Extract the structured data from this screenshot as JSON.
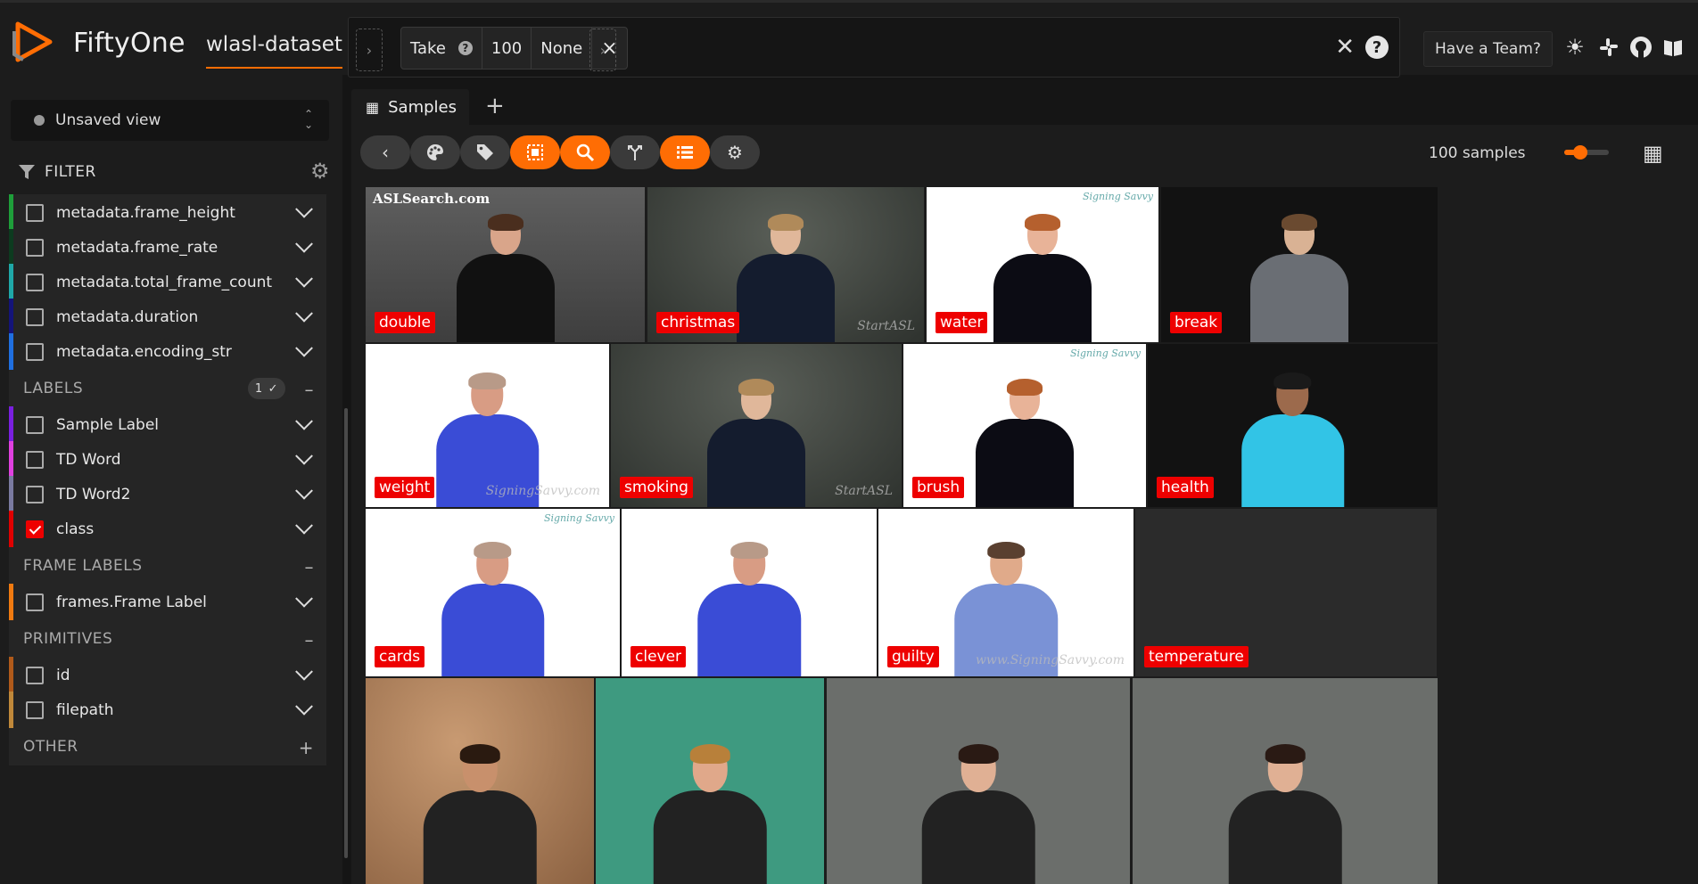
{
  "header": {
    "brand": "FiftyOne",
    "dataset_name": "wlasl-dataset",
    "view_stage": {
      "name": "Take",
      "help": "?",
      "value": "100",
      "seed": "None",
      "remove": "×"
    },
    "expand_left": "›",
    "expand_right": "›",
    "clear": "✕",
    "help": "?",
    "team_button": "Have a Team?",
    "icons": [
      "sun-icon",
      "slack-icon",
      "github-icon",
      "docs-icon"
    ]
  },
  "sidebar": {
    "saved_view": "Unsaved view",
    "filter_title": "FILTER",
    "metadata_fields": [
      {
        "label": "metadata.frame_height",
        "color": "#1e9e3a"
      },
      {
        "label": "metadata.frame_rate",
        "color": "#0d3b1f"
      },
      {
        "label": "metadata.total_frame_count",
        "color": "#1fa8a8"
      },
      {
        "label": "metadata.duration",
        "color": "#14147a"
      },
      {
        "label": "metadata.encoding_str",
        "color": "#1f6fe0"
      }
    ],
    "labels_group": {
      "title": "LABELS",
      "count": "1",
      "toggle": "–"
    },
    "label_fields": [
      {
        "label": "Sample Label",
        "color": "#7a1fe0",
        "checked": false
      },
      {
        "label": "TD Word",
        "color": "#e040e0",
        "checked": false
      },
      {
        "label": "TD Word2",
        "color": "#7a7aa0",
        "checked": false
      },
      {
        "label": "class",
        "color": "#e00000",
        "checked": true
      }
    ],
    "frame_labels_group": {
      "title": "FRAME LABELS",
      "toggle": "–"
    },
    "frame_label_fields": [
      {
        "label": "frames.Frame Label",
        "color": "#f07a10",
        "checked": false
      }
    ],
    "primitives_group": {
      "title": "PRIMITIVES",
      "toggle": "–"
    },
    "primitive_fields": [
      {
        "label": "id",
        "color": "#b05a1a",
        "checked": false
      },
      {
        "label": "filepath",
        "color": "#c0883a",
        "checked": false
      }
    ],
    "other_group": {
      "title": "OTHER",
      "toggle": "+"
    }
  },
  "tabs": {
    "samples": "Samples",
    "add": "+"
  },
  "actions": {
    "sample_count": "100 samples",
    "accent": "#ff6d04"
  },
  "gallery": {
    "samples": [
      {
        "label": "double",
        "watermark_tl": "ASLSearch.com"
      },
      {
        "label": "christmas",
        "watermark_br": "StartASL"
      },
      {
        "label": "water",
        "watermark_tr": "Signing Savvy"
      },
      {
        "label": "break"
      },
      {
        "label": "weight",
        "watermark_br": "SigningSavvy.com"
      },
      {
        "label": "smoking",
        "watermark_br": "StartASL"
      },
      {
        "label": "brush",
        "watermark_tr": "Signing Savvy"
      },
      {
        "label": "health"
      },
      {
        "label": "cards",
        "watermark_tr": "Signing Savvy"
      },
      {
        "label": "clever"
      },
      {
        "label": "guilty",
        "watermark_br": "www.SigningSavvy.com"
      },
      {
        "label": "temperature"
      },
      {
        "label": ""
      },
      {
        "label": ""
      },
      {
        "label": ""
      },
      {
        "label": ""
      }
    ]
  }
}
